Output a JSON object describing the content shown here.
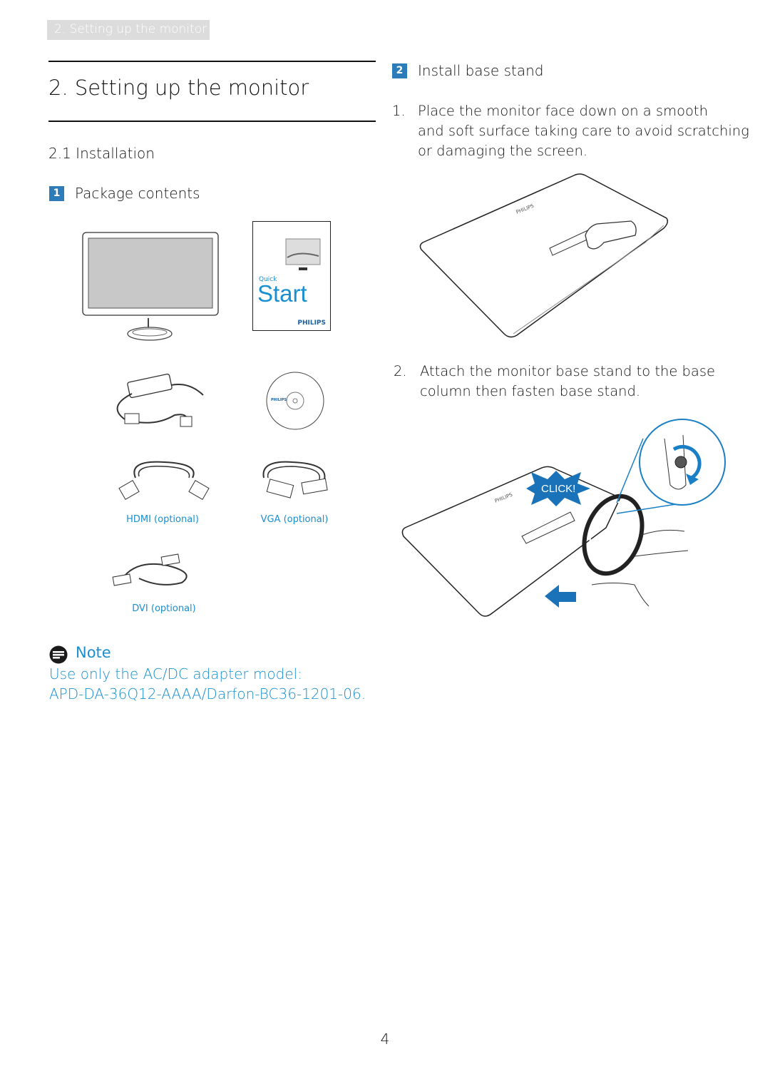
{
  "header_tab": "2. Setting up the monitor",
  "title": "2.  Setting up the monitor",
  "section": "2.1 Installation",
  "package": {
    "badge": "1",
    "label": "Package contents",
    "items": {
      "quick_start_small": "Quick",
      "quick_start_big": "Start",
      "brand": "PHILIPS",
      "hdmi": "HDMI (optional)",
      "vga": "VGA (optional)",
      "dvi": "DVI (optional)"
    }
  },
  "install": {
    "badge": "2",
    "label": "Install base stand",
    "steps": [
      {
        "num": "1.",
        "text_lines": [
          "Place the monitor face down on a smooth",
          "and soft surface taking care to avoid scratching",
          "or damaging the screen."
        ]
      },
      {
        "num": "2.",
        "text_lines": [
          "Attach the monitor base stand to the base",
          "column then fasten base stand."
        ]
      }
    ],
    "click_label": "CLICK!"
  },
  "note": {
    "icon": "note-icon",
    "title": "Note",
    "lines": [
      "Use only the AC/DC adapter model:",
      "APD-DA-36Q12-AAAA/Darfon-BC36-1201-06."
    ]
  },
  "page_number": "4",
  "colors": {
    "accent": "#1a8fd0",
    "badge": "#2b7cb8",
    "tab": "#dcdcdc"
  }
}
